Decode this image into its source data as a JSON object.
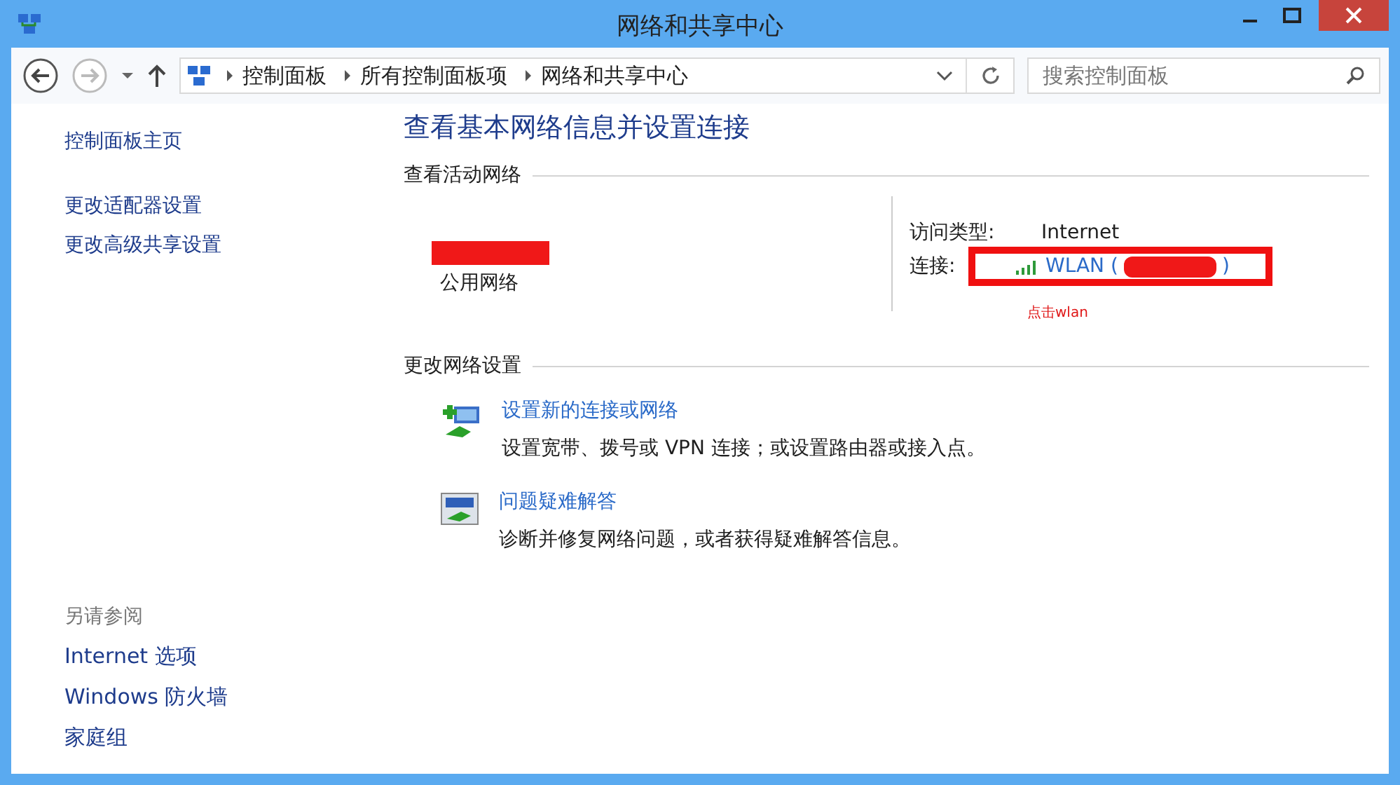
{
  "window": {
    "title": "网络和共享中心"
  },
  "address_bar": {
    "breadcrumbs": [
      "控制面板",
      "所有控制面板项",
      "网络和共享中心"
    ]
  },
  "search": {
    "placeholder": "搜索控制面板"
  },
  "sidebar": {
    "items": [
      "控制面板主页",
      "更改适配器设置",
      "更改高级共享设置"
    ],
    "see_also": {
      "heading": "另请参阅",
      "items": [
        "Internet 选项",
        "Windows 防火墙",
        "家庭组"
      ]
    }
  },
  "main": {
    "title": "查看基本网络信息并设置连接",
    "active_networks": {
      "heading": "查看活动网络",
      "network_type": "公用网络",
      "access_type_label": "访问类型:",
      "access_type": "Internet",
      "connection_label": "连接:",
      "connection_prefix": "WLAN (",
      "connection_suffix": ")"
    },
    "annotation": "点击wlan",
    "change_settings": {
      "heading": "更改网络设置",
      "tasks": [
        {
          "kind": "new-connection",
          "title": "设置新的连接或网络",
          "description": "设置宽带、拨号或 VPN 连接；或设置路由器或接入点。"
        },
        {
          "kind": "troubleshoot",
          "title": "问题疑难解答",
          "description": "诊断并修复网络问题，或者获得疑难解答信息。"
        }
      ]
    }
  }
}
